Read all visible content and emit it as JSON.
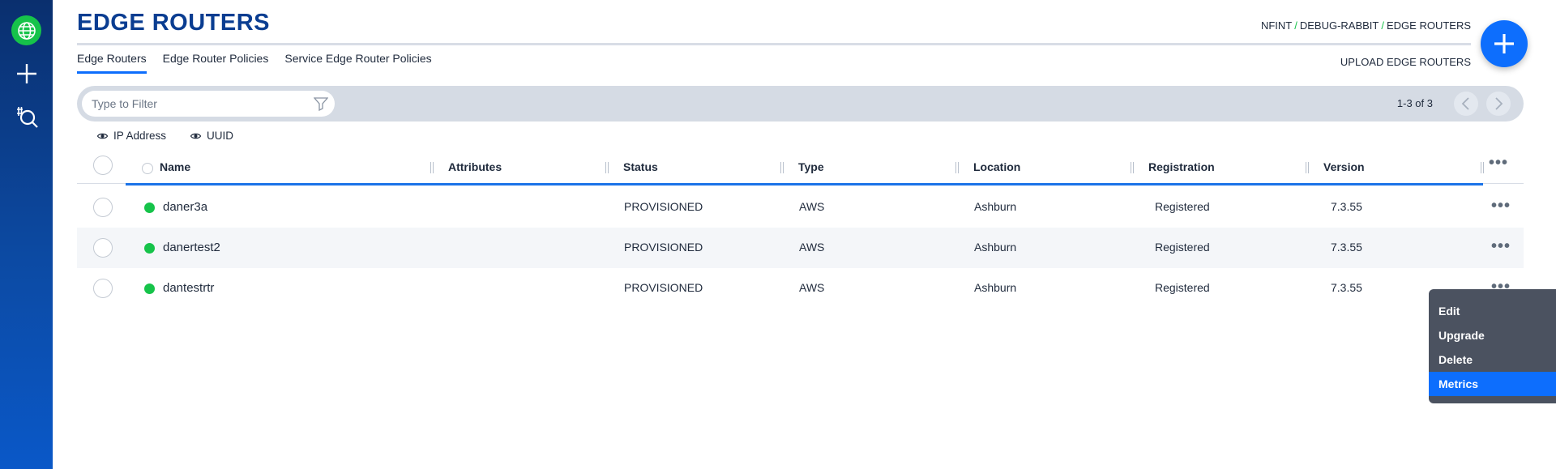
{
  "header": {
    "title": "EDGE ROUTERS",
    "breadcrumb": [
      "NFINT",
      "DEBUG-RABBIT",
      "EDGE ROUTERS"
    ],
    "breadcrumb_separator": "/"
  },
  "tabs": [
    {
      "label": "Edge Routers",
      "active": true
    },
    {
      "label": "Edge Router Policies",
      "active": false
    },
    {
      "label": "Service Edge Router Policies",
      "active": false
    }
  ],
  "upload_label": "UPLOAD EDGE ROUTERS",
  "filter": {
    "placeholder": "Type to Filter",
    "value": ""
  },
  "pager": {
    "label": "1-3 of 3"
  },
  "column_toggles": [
    "IP Address",
    "UUID"
  ],
  "table": {
    "columns": [
      "Name",
      "Attributes",
      "Status",
      "Type",
      "Location",
      "Registration",
      "Version"
    ],
    "rows": [
      {
        "name": "daner3a",
        "attributes": "",
        "status": "PROVISIONED",
        "type": "AWS",
        "location": "Ashburn",
        "registration": "Registered",
        "version": "7.3.55",
        "online": true
      },
      {
        "name": "danertest2",
        "attributes": "",
        "status": "PROVISIONED",
        "type": "AWS",
        "location": "Ashburn",
        "registration": "Registered",
        "version": "7.3.55",
        "online": true
      },
      {
        "name": "dantestrtr",
        "attributes": "",
        "status": "PROVISIONED",
        "type": "AWS",
        "location": "Ashburn",
        "registration": "Registered",
        "version": "7.3.55",
        "online": true
      }
    ]
  },
  "context_menu": {
    "items": [
      "Edit",
      "Upgrade",
      "Delete",
      "Metrics"
    ],
    "highlighted": "Metrics"
  },
  "icons": {
    "nav": [
      "globe-icon",
      "plus-icon",
      "search-tag-icon"
    ],
    "filter": "filter-icon",
    "pager": [
      "chevron-left-icon",
      "chevron-right-icon"
    ],
    "toggle": "eye-icon",
    "fab": "plus-icon",
    "row_actions": "more-dots-icon"
  },
  "colors": {
    "brand": "#0a3d91",
    "accent": "#0d6efd",
    "online": "#16c34a",
    "menu_bg": "#4b5260"
  }
}
